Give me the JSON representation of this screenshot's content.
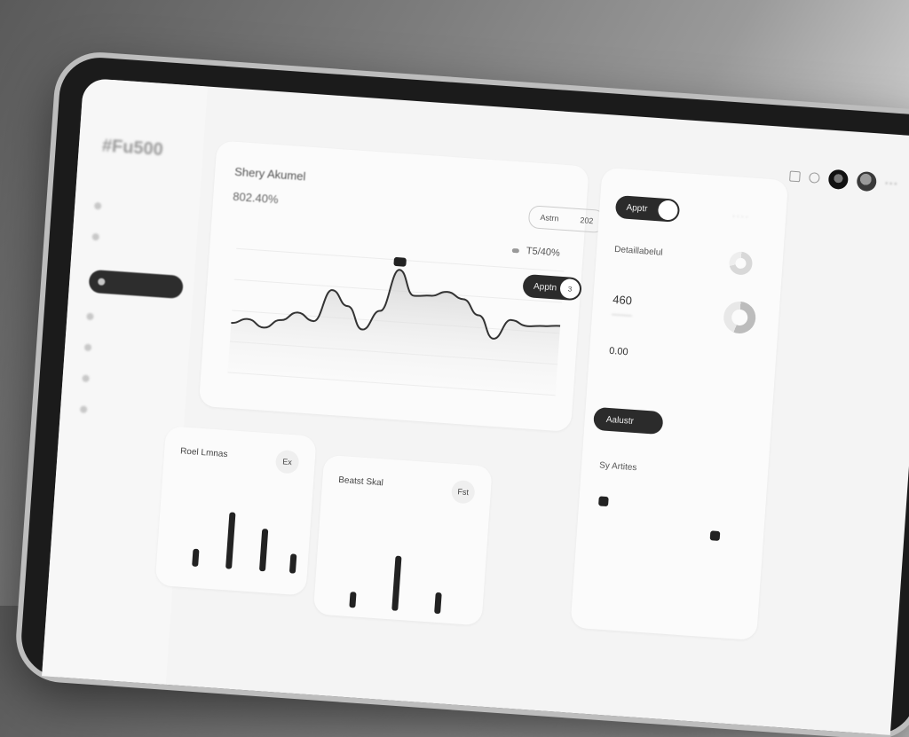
{
  "app": {
    "brand_top": "",
    "logo": "#Fu500",
    "breadcrumb": ""
  },
  "sidebar": {
    "items": [
      {
        "label": "",
        "count": ""
      },
      {
        "label": "",
        "count": ""
      },
      {
        "label": "",
        "count": ""
      },
      {
        "label": "",
        "count": ""
      },
      {
        "label": "",
        "count": ""
      },
      {
        "label": "",
        "count": ""
      },
      {
        "label": "",
        "count": ""
      }
    ],
    "active_index": 2
  },
  "main": {
    "title": "Shery Akumel",
    "value": "802.40%",
    "filter_pill": {
      "left": "Astrn",
      "right": "202"
    },
    "legend_value": "T5/40%",
    "toggle_label": "Apptn"
  },
  "side": {
    "toggle_label": "Apptr",
    "section_label": "Detaillabelul",
    "big_value_1": "460",
    "big_value_2": "0.00",
    "pill_label": "Aalustr",
    "list_label": "Sy Artites"
  },
  "bar_cards": [
    {
      "title": "Roel Lmnas",
      "button": "Ex"
    },
    {
      "title": "Beatst Skal",
      "button": "Fst"
    }
  ],
  "chart_data": {
    "type": "area",
    "title": "Shery Akumel",
    "x_tick_labels": [
      "",
      "",
      "",
      "",
      "",
      "",
      "",
      ""
    ],
    "y_tick_labels": [
      "",
      "",
      "",
      "",
      ""
    ],
    "series": [
      {
        "values": [
          40,
          44,
          38,
          45,
          52,
          46,
          72,
          60,
          42,
          58,
          92,
          72,
          73,
          77,
          72,
          60,
          42,
          58,
          54,
          55,
          56
        ]
      }
    ],
    "annotations": [
      {
        "text": "",
        "at_index": 10
      }
    ],
    "grid": true,
    "legend": "none"
  },
  "colors": {
    "accent": "#2b2b2b",
    "background": "#f4f4f4",
    "card": "#fbfbfb"
  }
}
